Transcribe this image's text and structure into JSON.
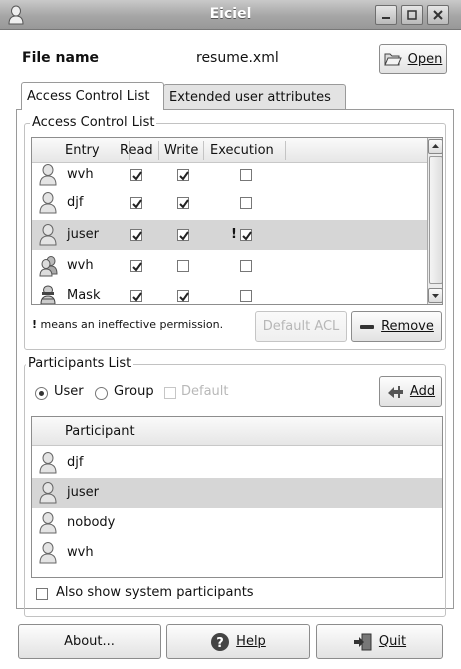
{
  "window": {
    "title": "Eiciel"
  },
  "file": {
    "label": "File name",
    "name": "resume.xml",
    "open_label": "Open"
  },
  "tabs": [
    {
      "label": "Access Control List"
    },
    {
      "label": "Extended user attributes"
    }
  ],
  "acl": {
    "frame_label": "Access Control List",
    "columns": [
      "Entry",
      "Read",
      "Write",
      "Execution"
    ],
    "rows": [
      {
        "icon": "user-icon",
        "entry": "wvh",
        "read": true,
        "write": true,
        "exec": false,
        "ineffective": false
      },
      {
        "icon": "user-icon",
        "entry": "djf",
        "read": true,
        "write": true,
        "exec": false,
        "ineffective": false
      },
      {
        "icon": "user-icon",
        "entry": "juser",
        "read": true,
        "write": true,
        "exec": true,
        "ineffective": true,
        "ineffective_mark": "!"
      },
      {
        "icon": "group-icon",
        "entry": "wvh",
        "read": true,
        "write": false,
        "exec": false,
        "ineffective": false
      },
      {
        "icon": "mask-icon",
        "entry": "Mask",
        "read": true,
        "write": true,
        "exec": false,
        "ineffective": false
      }
    ],
    "note_mark": "!",
    "note_text": "means an ineffective permission.",
    "default_acl_label": "Default ACL",
    "remove_label": "Remove"
  },
  "participants": {
    "frame_label": "Participants List",
    "user_label": "User",
    "group_label": "Group",
    "default_label": "Default",
    "selected_type": "User",
    "add_label": "Add",
    "column": "Participant",
    "rows": [
      {
        "icon": "user-icon",
        "name": "djf"
      },
      {
        "icon": "user-icon",
        "name": "juser"
      },
      {
        "icon": "user-icon",
        "name": "nobody"
      },
      {
        "icon": "user-icon",
        "name": "wvh"
      }
    ],
    "show_system_label": "Also show system participants"
  },
  "footer": {
    "about_label": "About...",
    "help_label": "Help",
    "quit_label": "Quit"
  }
}
